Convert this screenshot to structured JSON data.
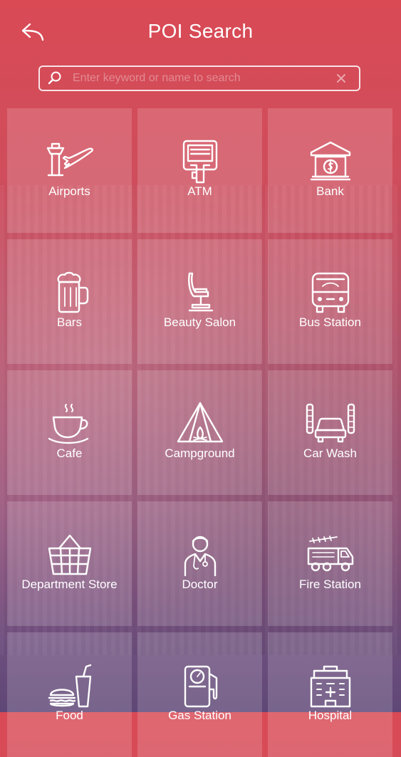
{
  "header": {
    "title": "POI Search",
    "back_icon": "back-arrow-icon"
  },
  "search": {
    "placeholder": "Enter keyword or name to search",
    "value": "",
    "icon": "search-icon",
    "clear_icon": "close-icon"
  },
  "categories": [
    {
      "label": "Airports",
      "icon": "airport-icon"
    },
    {
      "label": "ATM",
      "icon": "atm-icon"
    },
    {
      "label": "Bank",
      "icon": "bank-icon"
    },
    {
      "label": "Bars",
      "icon": "beer-mug-icon"
    },
    {
      "label": "Beauty Salon",
      "icon": "salon-chair-icon"
    },
    {
      "label": "Bus Station",
      "icon": "bus-icon"
    },
    {
      "label": "Cafe",
      "icon": "coffee-cup-icon"
    },
    {
      "label": "Campground",
      "icon": "tent-icon"
    },
    {
      "label": "Car Wash",
      "icon": "car-wash-icon"
    },
    {
      "label": "Department Store",
      "icon": "shopping-basket-icon"
    },
    {
      "label": "Doctor",
      "icon": "doctor-icon"
    },
    {
      "label": "Fire Station",
      "icon": "fire-truck-icon"
    },
    {
      "label": "Food",
      "icon": "fast-food-icon"
    },
    {
      "label": "Gas Station",
      "icon": "gas-pump-icon"
    },
    {
      "label": "Hospital",
      "icon": "hospital-icon"
    }
  ],
  "colors": {
    "gradient_top": "#d94a55",
    "gradient_bottom": "#5e4776",
    "tile": "rgba(255,255,255,0.16)",
    "text": "#ffffff"
  }
}
